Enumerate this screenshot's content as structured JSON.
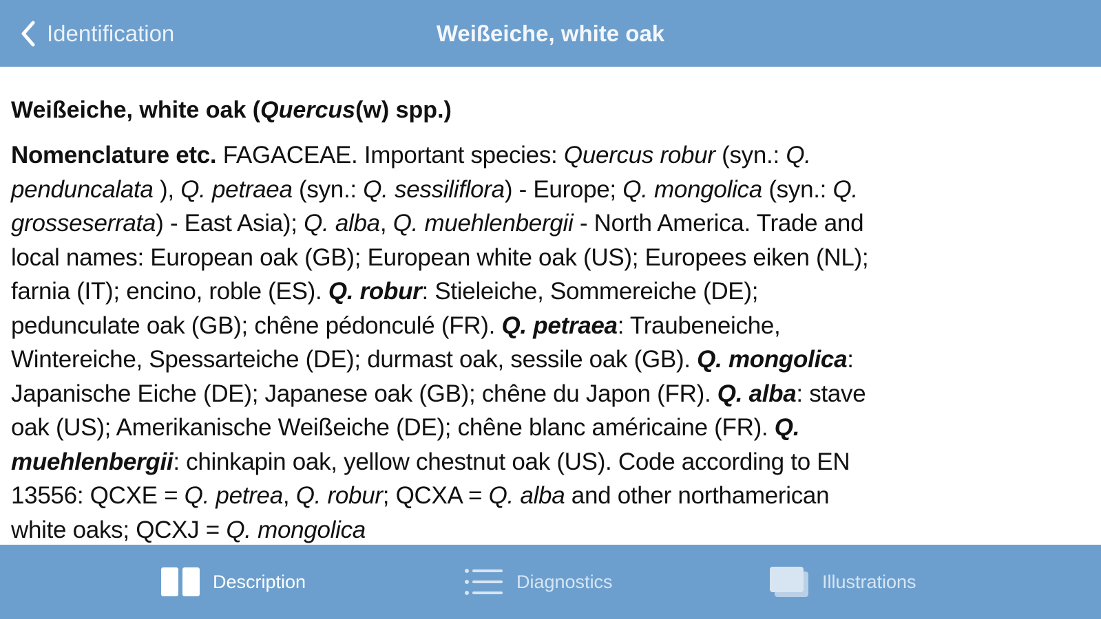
{
  "navbar": {
    "back_label": "Identification",
    "title": "Weißeiche, white oak"
  },
  "content": {
    "heading_parts": [
      {
        "t": "Weißeiche, white oak (",
        "s": "b"
      },
      {
        "t": "Quercus",
        "s": "bi"
      },
      {
        "t": "(w) spp.)",
        "s": "b"
      }
    ],
    "lines": [
      [
        {
          "t": "Nomenclature etc.",
          "s": "b"
        },
        {
          "t": " FAGACEAE. Important species: ",
          "s": "n"
        },
        {
          "t": "Quercus robur",
          "s": "i"
        },
        {
          "t": " (syn.: ",
          "s": "n"
        },
        {
          "t": "Q.",
          "s": "i"
        }
      ],
      [
        {
          "t": "penduncalata",
          "s": "i"
        },
        {
          "t": " ), ",
          "s": "n"
        },
        {
          "t": "Q. petraea",
          "s": "i"
        },
        {
          "t": " (syn.: ",
          "s": "n"
        },
        {
          "t": "Q. sessiliflora",
          "s": "i"
        },
        {
          "t": ") - Europe; ",
          "s": "n"
        },
        {
          "t": "Q. mongolica",
          "s": "i"
        },
        {
          "t": " (syn.: ",
          "s": "n"
        },
        {
          "t": "Q.",
          "s": "i"
        }
      ],
      [
        {
          "t": "grosseserrata",
          "s": "i"
        },
        {
          "t": ") - East Asia); ",
          "s": "n"
        },
        {
          "t": "Q. alba",
          "s": "i"
        },
        {
          "t": ", ",
          "s": "n"
        },
        {
          "t": "Q. muehlenbergii",
          "s": "i"
        },
        {
          "t": " - North America. Trade and",
          "s": "n"
        }
      ],
      [
        {
          "t": "local names: European oak (GB); European white oak (US); Europees eiken (NL);",
          "s": "n"
        }
      ],
      [
        {
          "t": "farnia (IT); encino, roble (ES). ",
          "s": "n"
        },
        {
          "t": "Q. robur",
          "s": "bi"
        },
        {
          "t": ": Stieleiche, Sommereiche (DE);",
          "s": "n"
        }
      ],
      [
        {
          "t": "pedunculate oak (GB); chêne pédonculé (FR). ",
          "s": "n"
        },
        {
          "t": "Q. petraea",
          "s": "bi"
        },
        {
          "t": ": Traubeneiche,",
          "s": "n"
        }
      ],
      [
        {
          "t": "Wintereiche, Spessarteiche (DE); durmast oak, sessile oak (GB). ",
          "s": "n"
        },
        {
          "t": "Q. mongolica",
          "s": "bi"
        },
        {
          "t": ":",
          "s": "n"
        }
      ],
      [
        {
          "t": "Japanische Eiche (DE); Japanese oak (GB); chêne du Japon (FR). ",
          "s": "n"
        },
        {
          "t": "Q. alba",
          "s": "bi"
        },
        {
          "t": ": stave",
          "s": "n"
        }
      ],
      [
        {
          "t": "oak (US); Amerikanische Weißeiche (DE); chêne blanc américaine (FR). ",
          "s": "n"
        },
        {
          "t": "Q.",
          "s": "bi"
        }
      ],
      [
        {
          "t": "muehlenbergii",
          "s": "bi"
        },
        {
          "t": ": chinkapin oak, yellow chestnut oak (US). Code according to EN",
          "s": "n"
        }
      ],
      [
        {
          "t": "13556: QCXE = ",
          "s": "n"
        },
        {
          "t": "Q. petrea",
          "s": "i"
        },
        {
          "t": ", ",
          "s": "n"
        },
        {
          "t": "Q. robur",
          "s": "i"
        },
        {
          "t": "; QCXA = ",
          "s": "n"
        },
        {
          "t": "Q. alba",
          "s": "i"
        },
        {
          "t": " and other northamerican",
          "s": "n"
        }
      ],
      [
        {
          "t": "white oaks; QCXJ = ",
          "s": "n"
        },
        {
          "t": "Q. mongolica",
          "s": "i"
        }
      ]
    ]
  },
  "tabs": [
    {
      "label": "Description",
      "icon": "book-icon",
      "state": "active"
    },
    {
      "label": "Diagnostics",
      "icon": "list-icon",
      "state": "inactive"
    },
    {
      "label": "Illustrations",
      "icon": "gallery-icon",
      "state": "inactive"
    }
  ],
  "colors": {
    "bar": "#6c9fcd",
    "text": "#111111",
    "tab_active": "#ffffff",
    "tab_inactive": "#d7e5f3"
  }
}
